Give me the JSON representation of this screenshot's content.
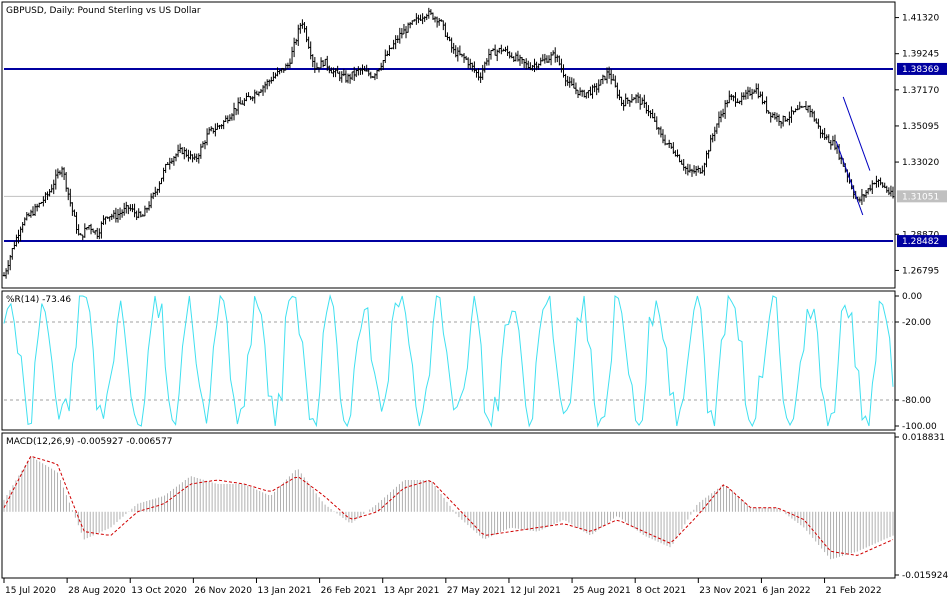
{
  "chart_data": [
    {
      "type": "candlestick",
      "title": "GBPUSD, Daily:  Pound Sterling vs US Dollar",
      "ylim": [
        1.259,
        1.421
      ],
      "y_ticks": [
        "1.41320",
        "1.39245",
        "1.37170",
        "1.35095",
        "1.33020",
        "1.28870",
        "1.26795"
      ],
      "y_tick_values": [
        1.4132,
        1.39245,
        1.3717,
        1.35095,
        1.3302,
        1.2887,
        1.26795
      ],
      "hlines": [
        {
          "value": 1.38369,
          "label": "1.38369",
          "color": "#0000a0"
        },
        {
          "value": 1.28482,
          "label": "1.28482",
          "color": "#0000a0"
        }
      ],
      "current_price": {
        "value": 1.31051,
        "label": "1.31051",
        "color": "#c0c0c0"
      },
      "trendlines": [
        {
          "x": [
            0.944,
            0.974
          ],
          "y": [
            1.3676,
            1.3253
          ]
        },
        {
          "x": [
            0.936,
            0.966
          ],
          "y": [
            1.3422,
            1.2998
          ]
        }
      ],
      "close_series_x": [
        0,
        0.01,
        0.02,
        0.035,
        0.05,
        0.065,
        0.075,
        0.085,
        0.095,
        0.105,
        0.115,
        0.125,
        0.14,
        0.155,
        0.17,
        0.185,
        0.2,
        0.215,
        0.23,
        0.245,
        0.26,
        0.275,
        0.29,
        0.305,
        0.32,
        0.335,
        0.35,
        0.36,
        0.37,
        0.385,
        0.4,
        0.415,
        0.43,
        0.445,
        0.46,
        0.475,
        0.49,
        0.505,
        0.52,
        0.535,
        0.545,
        0.56,
        0.575,
        0.59,
        0.605,
        0.62,
        0.635,
        0.65,
        0.665,
        0.68,
        0.695,
        0.71,
        0.725,
        0.74,
        0.755,
        0.77,
        0.785,
        0.8,
        0.815,
        0.83,
        0.845,
        0.86,
        0.875,
        0.89,
        0.905,
        0.92,
        0.935,
        0.95,
        0.96,
        0.97,
        0.98,
        0.99,
        1.0
      ],
      "close_series": [
        1.265,
        1.281,
        1.295,
        1.303,
        1.312,
        1.328,
        1.306,
        1.286,
        1.294,
        1.289,
        1.3,
        1.299,
        1.304,
        1.298,
        1.313,
        1.331,
        1.337,
        1.331,
        1.347,
        1.352,
        1.361,
        1.367,
        1.373,
        1.38,
        1.386,
        1.412,
        1.384,
        1.388,
        1.382,
        1.378,
        1.383,
        1.38,
        1.391,
        1.403,
        1.41,
        1.416,
        1.412,
        1.394,
        1.389,
        1.379,
        1.392,
        1.395,
        1.39,
        1.385,
        1.388,
        1.392,
        1.375,
        1.369,
        1.372,
        1.382,
        1.364,
        1.368,
        1.36,
        1.344,
        1.336,
        1.324,
        1.326,
        1.35,
        1.367,
        1.366,
        1.373,
        1.359,
        1.354,
        1.359,
        1.362,
        1.346,
        1.34,
        1.321,
        1.307,
        1.313,
        1.32,
        1.316,
        1.31
      ]
    },
    {
      "type": "line",
      "title": "%R(14) -73.46",
      "ylim": [
        -100,
        0
      ],
      "y_ticks": [
        "0.00",
        "-20.00",
        "-80.00",
        "-100.00"
      ],
      "y_tick_values": [
        0,
        -20,
        -80,
        -100
      ],
      "levels": [
        -20,
        -80
      ],
      "series_color": "#40e0f0"
    },
    {
      "type": "bar+line",
      "title": "MACD(12,26,9) -0.005927 -0.006577",
      "ylim": [
        -0.015924,
        0.018831
      ],
      "y_ticks": [
        "0.018831",
        "-0.015924"
      ],
      "y_tick_values": [
        0.018831,
        -0.015924
      ],
      "histogram_color": "#b0b0b0",
      "signal_color": "#d00000",
      "macd_x": [
        0,
        0.03,
        0.06,
        0.09,
        0.12,
        0.15,
        0.18,
        0.21,
        0.24,
        0.27,
        0.3,
        0.33,
        0.36,
        0.39,
        0.42,
        0.45,
        0.48,
        0.51,
        0.54,
        0.57,
        0.6,
        0.63,
        0.66,
        0.69,
        0.72,
        0.75,
        0.78,
        0.81,
        0.84,
        0.87,
        0.9,
        0.93,
        0.96,
        1.0
      ],
      "macd": [
        0.003,
        0.014,
        0.01,
        -0.007,
        -0.004,
        0.002,
        0.004,
        0.009,
        0.007,
        0.007,
        0.004,
        0.011,
        0.002,
        -0.003,
        0.002,
        0.008,
        0.008,
        -0.001,
        -0.007,
        -0.004,
        -0.005,
        -0.002,
        -0.006,
        -0.001,
        -0.006,
        -0.009,
        0.002,
        0.007,
        0.001,
        0.001,
        -0.004,
        -0.012,
        -0.01,
        -0.006
      ],
      "signal": [
        0.001,
        0.014,
        0.012,
        -0.005,
        -0.006,
        0.0,
        0.002,
        0.007,
        0.008,
        0.007,
        0.005,
        0.009,
        0.004,
        -0.002,
        0.0,
        0.006,
        0.008,
        0.001,
        -0.006,
        -0.005,
        -0.004,
        -0.003,
        -0.005,
        -0.002,
        -0.005,
        -0.008,
        -0.001,
        0.007,
        0.001,
        0.001,
        -0.002,
        -0.01,
        -0.011,
        -0.007
      ]
    }
  ],
  "x_axis": {
    "ticks": [
      "15 Jul 2020",
      "28 Aug 2020",
      "13 Oct 2020",
      "26 Nov 2020",
      "13 Jan 2021",
      "26 Feb 2021",
      "13 Apr 2021",
      "27 May 2021",
      "12 Jul 2021",
      "25 Aug 2021",
      "8 Oct 2021",
      "23 Nov 2021",
      "6 Jan 2022",
      "21 Feb 2022"
    ],
    "tick_positions": [
      0,
      0.071,
      0.142,
      0.213,
      0.284,
      0.355,
      0.426,
      0.497,
      0.568,
      0.639,
      0.71,
      0.781,
      0.852,
      0.923
    ]
  }
}
